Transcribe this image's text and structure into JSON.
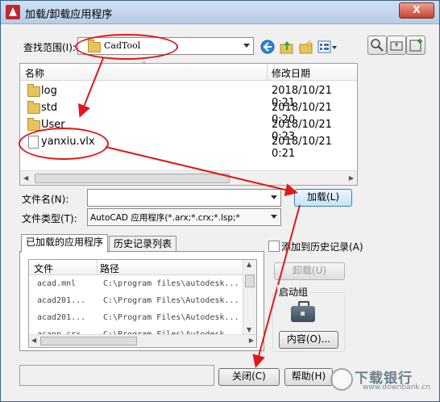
{
  "window": {
    "title": "加载/卸载应用程序",
    "close_label": "X"
  },
  "lookin": {
    "label": "查找范围(I):",
    "value": "CadTool"
  },
  "file_list": {
    "col_name": "名称",
    "col_date": "修改日期",
    "rows": [
      {
        "name": "log",
        "date": "2018/10/21 0:21",
        "type": "folder"
      },
      {
        "name": "std",
        "date": "2018/10/21 0:20",
        "type": "folder"
      },
      {
        "name": "User",
        "date": "2018/10/21 0:23",
        "type": "folder"
      },
      {
        "name": "yanxiu.vlx",
        "date": "2018/10/21 0:21",
        "type": "file"
      }
    ]
  },
  "filename": {
    "label": "文件名(N):",
    "value": ""
  },
  "filetype": {
    "label": "文件类型(T):",
    "value": "AutoCAD 应用程序(*.arx;*.crx;*.lsp;*"
  },
  "buttons": {
    "load": "加载(L)",
    "unload": "卸载(U)",
    "contents": "内容(O)...",
    "close": "关闭(C)",
    "help": "帮助(H)"
  },
  "tabs": {
    "loaded": "已加载的应用程序",
    "history": "历史记录列表"
  },
  "loaded_apps": {
    "col_file": "文件",
    "col_path": "路径",
    "rows": [
      {
        "file": "acad.mnl",
        "path": "C:\\program files\\autodesk..."
      },
      {
        "file": "acad201...",
        "path": "C:\\Program Files\\Autodesk..."
      },
      {
        "file": "acad201...",
        "path": "C:\\Program Files\\Autodesk..."
      },
      {
        "file": "acapp.crx",
        "path": "C:\\Program Files\\Autodesk..."
      }
    ]
  },
  "add_history": {
    "label": "添加到历史记录(A)",
    "checked": false
  },
  "startup_group": {
    "label": "启动组"
  },
  "watermark": {
    "text": "下载银行",
    "url": "www.downbank.cn"
  }
}
